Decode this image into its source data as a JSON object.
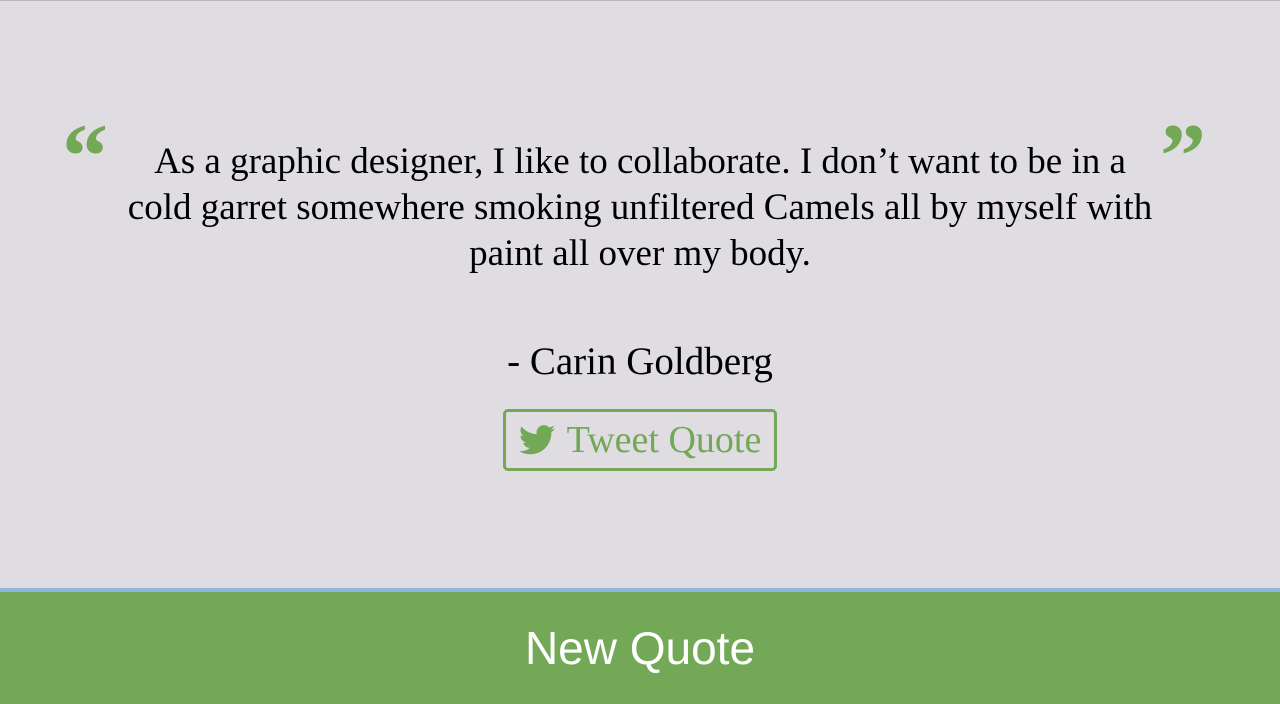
{
  "quote": {
    "open_mark": "“",
    "close_mark": "”",
    "text": "As a graphic designer, I like to collaborate. I don’t want to be in a cold garret somewhere smoking unfiltered Camels all by myself with paint all over my body.",
    "author": "- Carin Goldberg"
  },
  "tweet_button": {
    "label": "Tweet Quote",
    "icon": "twitter-bird-icon"
  },
  "new_quote_button": {
    "label": "New Quote"
  },
  "colors": {
    "background": "#dfdce2",
    "accent": "#72a856",
    "divider": "#8fb7dd",
    "text": "#000000",
    "button_text": "#ffffff"
  }
}
